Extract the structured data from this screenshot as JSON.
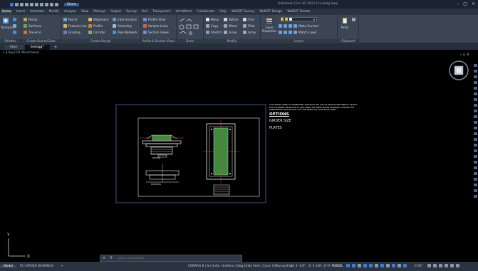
{
  "titlebar": {
    "title": "Autodesk Civil 3D 2022   Envikalg.dwg",
    "share_label": "Share"
  },
  "ribbon_tabs": [
    "Home",
    "Insert",
    "Annotate",
    "Modify",
    "Analyze",
    "View",
    "Manage",
    "Output",
    "Survey",
    "Rail",
    "Transparent",
    "InfraWorks",
    "Collaborate",
    "Help",
    "WaDOT Survey",
    "WaDOT Design",
    "WaDOT Sheets"
  ],
  "ribbon": {
    "palettes_label": "Palettes",
    "ground_data_label": "Create Ground Data",
    "design_label": "Create Design",
    "profile_section_label": "Profile & Section Views",
    "draw_label": "Draw",
    "modify_label": "Modify",
    "layers_label": "Layers",
    "clipboard_label": "Clipboard",
    "toolspace_label": "Toolspace",
    "points_label": "Points",
    "surfaces_label": "Surfaces",
    "traverse_label": "Traverse",
    "parcel_label": "Parcel",
    "feature_line_label": "Feature Line",
    "grading_label": "Grading",
    "alignment_label": "Alignment",
    "profile_label": "Profile",
    "corridor_label": "Corridor",
    "intersections_label": "Intersections",
    "assembly_label": "Assembly",
    "pipe_network_label": "Pipe Network",
    "profile_view_label": "Profile View",
    "sample_lines_label": "Sample Lines",
    "section_views_label": "Section Views",
    "move_label": "Move",
    "rotate_label": "Rotate",
    "trim_label": "Trim",
    "copy_label": "Copy",
    "mirror_label": "Mirror",
    "fillet_label": "Fillet",
    "stretch_label": "Stretch",
    "scale_label": "Scale",
    "array_label": "Array",
    "layer_properties_label": "Layer Properties",
    "make_current_label": "Make Current",
    "match_layer_label": "Match Layer",
    "paste_label": "Paste"
  },
  "doc_tabs": [
    "Start",
    "livelagg*"
  ],
  "canvas": {
    "view_label": "[-][Top][2D Wireframe]"
  },
  "drawing": {
    "note_text": "THIS INSERT SHEET IS GENERATED THROUGH THE USE OF DROP-DOWN MENUS. SELECT EACH ELEMENT INDIVIDUALLY AND USING THE DROP-DOWN TRIANGLE, CHOOSE THE APPROPRIATE OPTION THAT FITS THE NEEDS OF YOUR PLAN SHEET.",
    "options_label": "OPTIONS",
    "girder_size_label": "GIRDER SIZE",
    "plates_label": "PLATES",
    "section_label": "SECTION",
    "elevation_label": "ELEVATION"
  },
  "command": {
    "placeholder": "Type a command"
  },
  "statusbar": {
    "layout_tabs": [
      "Model",
      "PC-GIRDER BEARINGS"
    ],
    "coords": "CENARG 8 | Ini Units: Unitless | Dwg Units Feet | Conv: USSurveyFoot",
    "coords_right": "4 : 1'-1/4\",  -1'-1 1/8\",  0'-0\"",
    "model_label": "MODEL",
    "scale": "0.50\""
  },
  "colors": {
    "accent": "#3d7bd6",
    "ribbon_bg": "#3b4554",
    "drawing_lines": "#f2f2f2",
    "layout_frame": "#4f6aa8"
  }
}
